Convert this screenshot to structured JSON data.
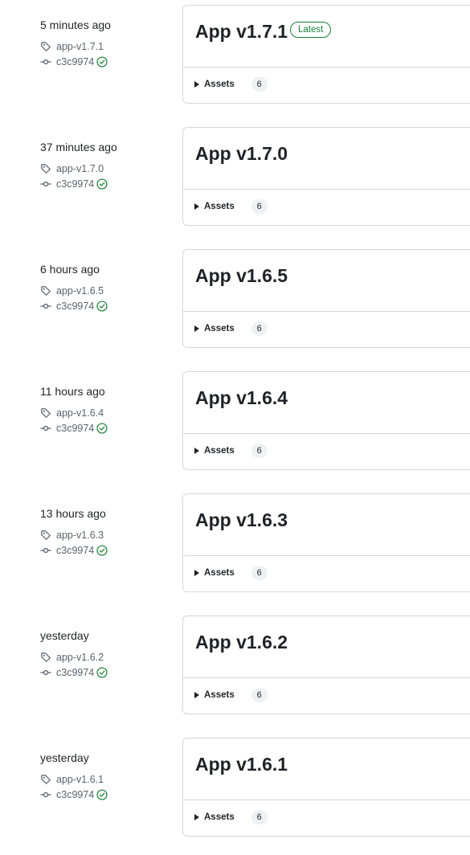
{
  "releases": [
    {
      "time": "5 minutes ago",
      "tag": "app-v1.7.1",
      "commit": "c3c9974",
      "verified": true,
      "title": "App v1.7.1",
      "latest": true,
      "assets_label": "Assets",
      "assets_count": "6"
    },
    {
      "time": "37 minutes ago",
      "tag": "app-v1.7.0",
      "commit": "c3c9974",
      "verified": true,
      "title": "App v1.7.0",
      "latest": false,
      "assets_label": "Assets",
      "assets_count": "6"
    },
    {
      "time": "6 hours ago",
      "tag": "app-v1.6.5",
      "commit": "c3c9974",
      "verified": true,
      "title": "App v1.6.5",
      "latest": false,
      "assets_label": "Assets",
      "assets_count": "6"
    },
    {
      "time": "11 hours ago",
      "tag": "app-v1.6.4",
      "commit": "c3c9974",
      "verified": true,
      "title": "App v1.6.4",
      "latest": false,
      "assets_label": "Assets",
      "assets_count": "6"
    },
    {
      "time": "13 hours ago",
      "tag": "app-v1.6.3",
      "commit": "c3c9974",
      "verified": true,
      "title": "App v1.6.3",
      "latest": false,
      "assets_label": "Assets",
      "assets_count": "6"
    },
    {
      "time": "yesterday",
      "tag": "app-v1.6.2",
      "commit": "c3c9974",
      "verified": true,
      "title": "App v1.6.2",
      "latest": false,
      "assets_label": "Assets",
      "assets_count": "6"
    },
    {
      "time": "yesterday",
      "tag": "app-v1.6.1",
      "commit": "c3c9974",
      "verified": true,
      "title": "App v1.6.1",
      "latest": false,
      "assets_label": "Assets",
      "assets_count": "6"
    }
  ],
  "latest_badge_label": "Latest",
  "icons": {
    "tag": "tag-icon",
    "commit": "git-commit-icon",
    "verified": "check-circle-icon",
    "expand": "disclosure-triangle-icon"
  },
  "colors": {
    "text": "#1f2328",
    "muted": "#59636e",
    "border": "#d1d9e0",
    "success": "#1a7f37",
    "counter_bg": "#eff2f5"
  }
}
